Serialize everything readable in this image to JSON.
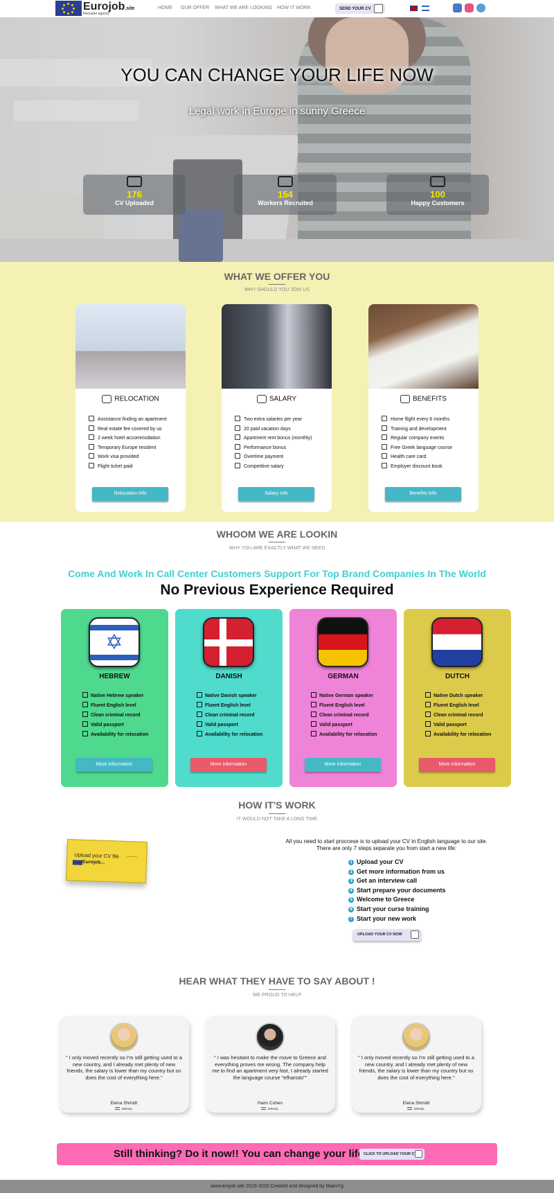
{
  "nav": {
    "logo_text": "Eurojob",
    "logo_suffix": ".site",
    "logo_tagline": "Recruiter agency",
    "links": [
      "HOME",
      "OUR OFFER",
      "WHAT WE ARE LOOKING",
      "HOW IT WORK"
    ],
    "send_cv": "SEND YOUR CV"
  },
  "hero": {
    "title": "YOU CAN CHANGE YOUR LIFE NOW",
    "subtitle": "Legal work in Europe in sunny Greece",
    "stats": [
      {
        "value": "176",
        "label": "CV Uploaded",
        "icon": "envelope-icon"
      },
      {
        "value": "154",
        "label": "Workers Recruited",
        "icon": "team-icon"
      },
      {
        "value": "100",
        "label": "Happy Customers",
        "icon": "customers-icon"
      }
    ]
  },
  "offer": {
    "title": "WHAT WE OFFER YOU",
    "subtitle": "WHY SHOULD YOU JOIN US",
    "cards": [
      {
        "title": "RELOCATION",
        "icon": "plane-icon",
        "items": [
          "Assistance finding an apartment",
          "Real estate fee covered by us",
          "2 week hotel accommodation",
          "Temporary Europe resident",
          "Work visa provided",
          "Flight ticket paid"
        ],
        "button": "Relocation Info"
      },
      {
        "title": "SALARY",
        "icon": "money-icon",
        "items": [
          "Two extra salaries per year",
          "20 paid vacation days",
          "Apartment rent bonus (monthly)",
          "Performance bonus",
          "Overtime payment",
          "Competitive salary"
        ],
        "button": "Salary Info"
      },
      {
        "title": "BENEFITS",
        "icon": "benefits-icon",
        "items": [
          "Home flight every 6 months",
          "Training and development",
          "Regular company events",
          "Free Greek language course",
          "Health care card",
          "Employer discount book"
        ],
        "button": "Benefits Info"
      }
    ]
  },
  "looking": {
    "title": "WHOOM WE ARE LOOKIN",
    "subtitle": "WHY YOU ARE EXACTLY WHAT WE NEED",
    "headline": "Come And Work In Call Center Customers Support For Top Brand Companies In The World",
    "subheadline": "No Previous Experience Required",
    "cards": [
      {
        "lang": "HEBREW",
        "items": [
          "Native Hebrew speaker",
          "Fluent English level",
          "Clean criminal record",
          "Valid passport",
          "Availability for relocation"
        ],
        "button": "More information"
      },
      {
        "lang": "DANISH",
        "items": [
          "Native Danish speaker",
          "Fluent English level",
          "Clean criminal record",
          "Valid passport",
          "Availability for relocation"
        ],
        "button": "More information"
      },
      {
        "lang": "GERMAN",
        "items": [
          "Native German speaker",
          "Fluent English level",
          "Clean criminal record",
          "Valid passport",
          "Availability for relocation"
        ],
        "button": "More information"
      },
      {
        "lang": "DUTCH",
        "items": [
          "Native Dutch speaker",
          "Fluent English level",
          "Clean criminal record",
          "Valid passport",
          "Availability for relocation"
        ],
        "button": "More information"
      }
    ]
  },
  "how": {
    "title": "HOW IT'S WORK",
    "subtitle": "IT WOULD NOT TAKE A LONG TIME",
    "intro_1": "All you need to start proccese is to upload your CV in English language to our site.",
    "intro_2": "There are only 7 steps separate you from start a new life:",
    "steps": [
      "Upload your CV",
      "Get more information from us",
      "Get an interview call",
      "Start prepare your documents",
      "Welcome to Greece",
      "Start your curse training",
      "Start your new work"
    ],
    "upload_button": "UPLOAD YOUR CV NOW",
    "note_text": "Upload your CV file",
    "note_logo": "Eurojob..."
  },
  "testimonials": {
    "title": "HEAR WHAT THEY HAVE TO SAY ABOUT !",
    "subtitle": "WE PROUD TO HELP",
    "items": [
      {
        "quote": "\" I only moved recently so I'm still getting used to a new country, and I already met plenty of new friends, the salary is lower than my country but so does the cost of everything here.\"",
        "name": "Elena Shmidt",
        "location": "ISRAEL"
      },
      {
        "quote": "\" I was hesitant to make the move to Greece and everything proves me wrong. The company help me to find an apartment very fast, I already started the language course \"efharisto\"\"",
        "name": "Haim Cohen",
        "location": "ISRAEL"
      },
      {
        "quote": "\" I only moved recently so I'm still getting used to a new country, and I already met plenty of new friends, the salary is lower than my country but so does the cost of everything here.\"",
        "name": "Elena Shmidt",
        "location": "ISRAEL"
      }
    ]
  },
  "cta": {
    "text": "Still thinking? Do it now!! You can change your life.",
    "button": "CLICK TO UPLOAD YOUR CV"
  },
  "footer": {
    "text": "www.erojob.site 2019-2020 Created and designed by MaksYg"
  },
  "colors": {
    "offer_bg": "#f5f1b4",
    "accent_teal": "#45b8c6",
    "hebrew_card": "#4fd98f",
    "danish_card": "#4fdccc",
    "german_card": "#ee83d8",
    "dutch_card": "#dccb4a",
    "cta_bg": "#fd6bb5",
    "stat_number": "#f5e800"
  }
}
